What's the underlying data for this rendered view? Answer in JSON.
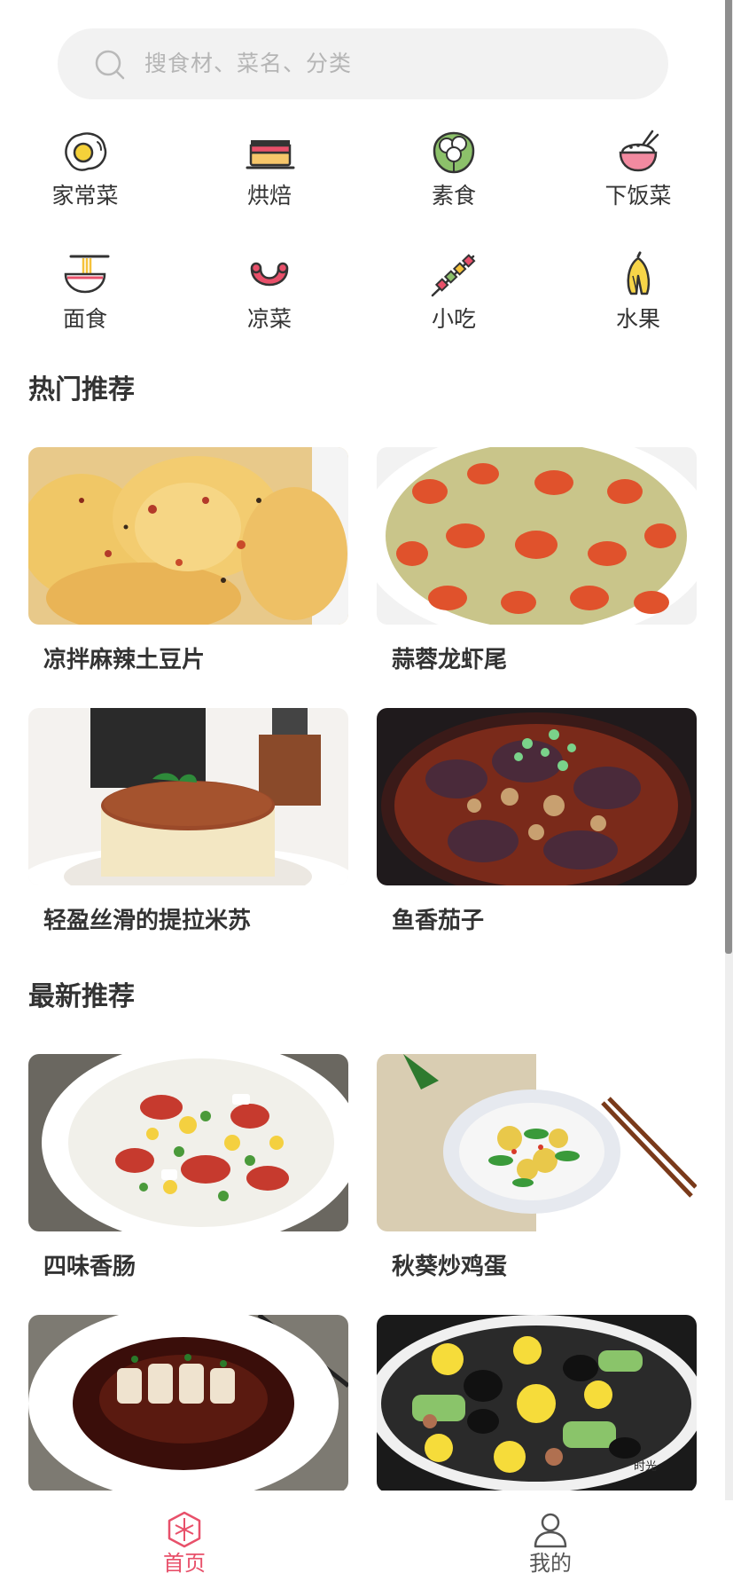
{
  "search": {
    "placeholder": "搜食材、菜名、分类",
    "icon": "search-icon"
  },
  "categories": [
    {
      "label": "家常菜",
      "icon": "fried-egg-icon"
    },
    {
      "label": "烘焙",
      "icon": "cake-slice-icon"
    },
    {
      "label": "素食",
      "icon": "cauliflower-icon"
    },
    {
      "label": "下饭菜",
      "icon": "rice-bowl-icon"
    },
    {
      "label": "面食",
      "icon": "noodle-bowl-icon"
    },
    {
      "label": "凉菜",
      "icon": "sausage-icon"
    },
    {
      "label": "小吃",
      "icon": "skewer-icon"
    },
    {
      "label": "水果",
      "icon": "banana-icon"
    }
  ],
  "hot": {
    "title": "热门推荐",
    "items": [
      {
        "title": "凉拌麻辣土豆片"
      },
      {
        "title": "蒜蓉龙虾尾"
      },
      {
        "title": "轻盈丝滑的提拉米苏"
      },
      {
        "title": "鱼香茄子"
      }
    ]
  },
  "latest": {
    "title": "最新推荐",
    "items": [
      {
        "title": "四味香肠"
      },
      {
        "title": "秋葵炒鸡蛋"
      },
      {
        "title": ""
      },
      {
        "title": ""
      }
    ]
  },
  "nav": {
    "home": "首页",
    "mine": "我的",
    "active_color": "#e8506a",
    "inactive_color": "#555555"
  },
  "photo_watermark": "时光"
}
